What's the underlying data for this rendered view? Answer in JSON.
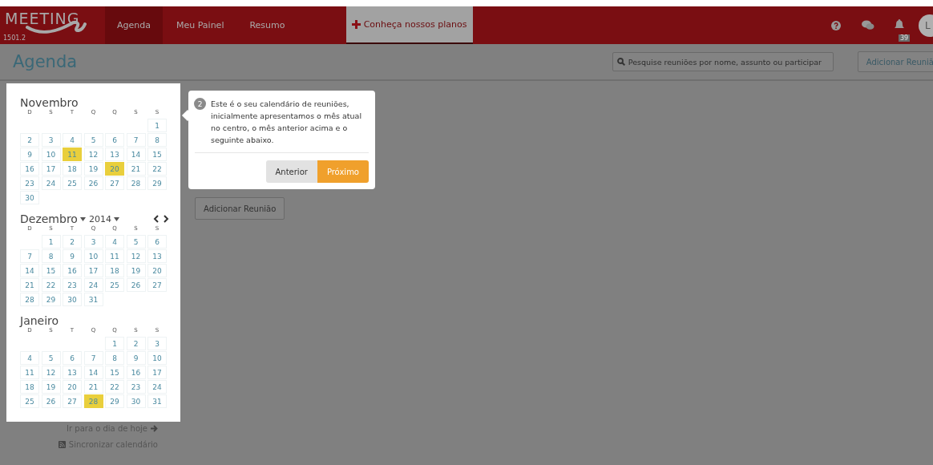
{
  "navbar": {
    "logo": "MEETING",
    "version": "1501.2",
    "tabs": [
      {
        "label": "Agenda",
        "selected": true
      },
      {
        "label": "Meu Painel",
        "selected": false
      },
      {
        "label": "Resumo",
        "selected": false
      }
    ],
    "plans_button": "Conheça nossos planos",
    "notifications_badge": "39",
    "avatar": "L"
  },
  "header": {
    "title": "Agenda",
    "search": {
      "placeholder": "Pesquise reuniões por nome, assunto ou participar"
    },
    "add_button": "Adicionar Reuniã"
  },
  "calendar": {
    "months": [
      {
        "name": "Novembro",
        "weekdays": [
          "D",
          "S",
          "T",
          "Q",
          "Q",
          "S",
          "S"
        ],
        "weeks": [
          [
            {
              "day": "1",
              "highlighted": false
            }
          ],
          [
            {
              "day": "2",
              "highlighted": false
            },
            {
              "day": "3",
              "highlighted": false
            },
            {
              "day": "4",
              "highlighted": false
            },
            {
              "day": "5",
              "highlighted": false
            },
            {
              "day": "6",
              "highlighted": false
            },
            {
              "day": "7",
              "highlighted": false
            },
            {
              "day": "8",
              "highlighted": false
            }
          ],
          [
            {
              "day": "9",
              "highlighted": false
            },
            {
              "day": "10",
              "highlighted": false
            },
            {
              "day": "11",
              "highlighted": true
            },
            {
              "day": "12",
              "highlighted": false
            },
            {
              "day": "13",
              "highlighted": false
            },
            {
              "day": "14",
              "highlighted": false
            },
            {
              "day": "15",
              "highlighted": false
            }
          ],
          [
            {
              "day": "16",
              "highlighted": false
            },
            {
              "day": "17",
              "highlighted": false
            },
            {
              "day": "18",
              "highlighted": false
            },
            {
              "day": "19",
              "highlighted": false
            },
            {
              "day": "20",
              "highlighted": true
            },
            {
              "day": "21",
              "highlighted": false
            },
            {
              "day": "22",
              "highlighted": false
            }
          ],
          [
            {
              "day": "23",
              "highlighted": false
            },
            {
              "day": "24",
              "highlighted": false
            },
            {
              "day": "25",
              "highlighted": false
            },
            {
              "day": "26",
              "highlighted": false
            },
            {
              "day": "27",
              "highlighted": false
            },
            {
              "day": "28",
              "highlighted": false
            },
            {
              "day": "29",
              "highlighted": false
            }
          ],
          [
            {
              "day": "30",
              "highlighted": false
            }
          ]
        ]
      },
      {
        "name": "Dezembro",
        "year": "2014",
        "weekdays": [
          "D",
          "S",
          "T",
          "Q",
          "Q",
          "S",
          "S"
        ],
        "weeks": [
          [
            {
              "day": "1",
              "highlighted": false
            },
            {
              "day": "2",
              "highlighted": false
            },
            {
              "day": "3",
              "highlighted": false
            },
            {
              "day": "4",
              "highlighted": false
            },
            {
              "day": "5",
              "highlighted": false
            },
            {
              "day": "6",
              "highlighted": false
            }
          ],
          [
            {
              "day": "7",
              "highlighted": false
            },
            {
              "day": "8",
              "highlighted": false
            },
            {
              "day": "9",
              "highlighted": false
            },
            {
              "day": "10",
              "highlighted": false
            },
            {
              "day": "11",
              "highlighted": false
            },
            {
              "day": "12",
              "highlighted": false
            },
            {
              "day": "13",
              "highlighted": false
            }
          ],
          [
            {
              "day": "14",
              "highlighted": false
            },
            {
              "day": "15",
              "highlighted": false
            },
            {
              "day": "16",
              "highlighted": false
            },
            {
              "day": "17",
              "highlighted": false
            },
            {
              "day": "18",
              "highlighted": false
            },
            {
              "day": "19",
              "highlighted": false
            },
            {
              "day": "20",
              "highlighted": false
            }
          ],
          [
            {
              "day": "21",
              "highlighted": false
            },
            {
              "day": "22",
              "highlighted": false
            },
            {
              "day": "23",
              "highlighted": false
            },
            {
              "day": "24",
              "highlighted": false
            },
            {
              "day": "25",
              "highlighted": false
            },
            {
              "day": "26",
              "highlighted": false
            },
            {
              "day": "27",
              "highlighted": false
            }
          ],
          [
            {
              "day": "28",
              "highlighted": false
            },
            {
              "day": "29",
              "highlighted": false
            },
            {
              "day": "30",
              "highlighted": false
            },
            {
              "day": "31",
              "highlighted": false
            }
          ]
        ]
      },
      {
        "name": "Janeiro",
        "weekdays": [
          "D",
          "S",
          "T",
          "Q",
          "Q",
          "S",
          "S"
        ],
        "weeks": [
          [
            {
              "day": "1",
              "highlighted": false
            },
            {
              "day": "2",
              "highlighted": false
            },
            {
              "day": "3",
              "highlighted": false
            }
          ],
          [
            {
              "day": "4",
              "highlighted": false
            },
            {
              "day": "5",
              "highlighted": false
            },
            {
              "day": "6",
              "highlighted": false
            },
            {
              "day": "7",
              "highlighted": false
            },
            {
              "day": "8",
              "highlighted": false
            },
            {
              "day": "9",
              "highlighted": false
            },
            {
              "day": "10",
              "highlighted": false
            }
          ],
          [
            {
              "day": "11",
              "highlighted": false
            },
            {
              "day": "12",
              "highlighted": false
            },
            {
              "day": "13",
              "highlighted": false
            },
            {
              "day": "14",
              "highlighted": false
            },
            {
              "day": "15",
              "highlighted": false
            },
            {
              "day": "16",
              "highlighted": false
            },
            {
              "day": "17",
              "highlighted": false
            }
          ],
          [
            {
              "day": "18",
              "highlighted": false
            },
            {
              "day": "19",
              "highlighted": false
            },
            {
              "day": "20",
              "highlighted": false
            },
            {
              "day": "21",
              "highlighted": false
            },
            {
              "day": "22",
              "highlighted": false
            },
            {
              "day": "23",
              "highlighted": false
            },
            {
              "day": "24",
              "highlighted": false
            }
          ],
          [
            {
              "day": "25",
              "highlighted": false
            },
            {
              "day": "26",
              "highlighted": false
            },
            {
              "day": "27",
              "highlighted": false
            },
            {
              "day": "28",
              "highlighted": true
            },
            {
              "day": "29",
              "highlighted": false
            },
            {
              "day": "30",
              "highlighted": false
            },
            {
              "day": "31",
              "highlighted": false
            }
          ]
        ]
      }
    ],
    "today_link": "Ir para o dia de hoje",
    "sync_link": "Sincronizar calendário"
  },
  "add_meeting_button": "Adicionar Reunião",
  "tour": {
    "step": "2",
    "text": "Este é o seu calendário de reuniões, inicialmente apresentamos o mês atual no centro, o mês anterior acima e o seguinte abaixo.",
    "buttons": [
      {
        "label": "Anterior",
        "kind": "secondary"
      },
      {
        "label": "Próximo",
        "kind": "primary"
      }
    ]
  }
}
